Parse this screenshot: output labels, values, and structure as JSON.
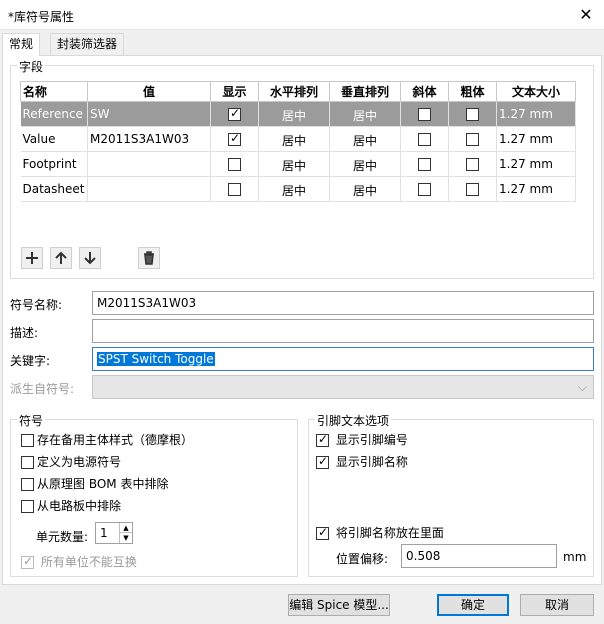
{
  "window": {
    "title": "*库符号属性",
    "close_glyph": "✕"
  },
  "tabs": [
    "常规",
    "封装筛选器"
  ],
  "fields_group": {
    "label": "字段",
    "columns": [
      "名称",
      "值",
      "显示",
      "水平排列",
      "垂直排列",
      "斜体",
      "粗体",
      "文本大小"
    ],
    "rows": [
      {
        "name": "Reference",
        "value": "SW",
        "show": true,
        "h_align": "居中",
        "v_align": "居中",
        "italic": false,
        "bold": false,
        "size": "1.27 mm",
        "selected": true
      },
      {
        "name": "Value",
        "value": "M2011S3A1W03",
        "show": true,
        "h_align": "居中",
        "v_align": "居中",
        "italic": false,
        "bold": false,
        "size": "1.27 mm",
        "selected": false
      },
      {
        "name": "Footprint",
        "value": "",
        "show": false,
        "h_align": "居中",
        "v_align": "居中",
        "italic": false,
        "bold": false,
        "size": "1.27 mm",
        "selected": false
      },
      {
        "name": "Datasheet",
        "value": "",
        "show": false,
        "h_align": "居中",
        "v_align": "居中",
        "italic": false,
        "bold": false,
        "size": "1.27 mm",
        "selected": false
      }
    ],
    "toolbar_icons": [
      "plus-icon",
      "arrow-up-icon",
      "arrow-down-icon",
      "trash-icon"
    ]
  },
  "form": {
    "symbol_name_label": "符号名称:",
    "symbol_name_value": "M2011S3A1W03",
    "description_label": "描述:",
    "description_value": "",
    "keywords_label": "关键字:",
    "keywords_value": "SPST Switch Toggle",
    "derived_label": "派生自符号:",
    "derived_value": ""
  },
  "symbol_group": {
    "label": "符号",
    "options": [
      {
        "label": "存在备用主体样式（德摩根）",
        "checked": false
      },
      {
        "label": "定义为电源符号",
        "checked": false
      },
      {
        "label": "从原理图 BOM 表中排除",
        "checked": false
      },
      {
        "label": "从电路板中排除",
        "checked": false
      }
    ],
    "unit_count_label": "单元数量:",
    "unit_count_value": "1",
    "interchangeable_label": "所有单位不能互换",
    "interchangeable_checked": true
  },
  "pin_group": {
    "label": "引脚文本选项",
    "show_pin_number_label": "显示引脚编号",
    "show_pin_number": true,
    "show_pin_name_label": "显示引脚名称",
    "show_pin_name": true,
    "pin_name_inside_label": "将引脚名称放在里面",
    "pin_name_inside": true,
    "offset_label": "位置偏移:",
    "offset_value": "0.508",
    "offset_unit": "mm"
  },
  "buttons": {
    "edit_spice": "编辑 Spice 模型...",
    "ok": "确定",
    "cancel": "取消"
  },
  "colors": {
    "selected_row": "#9b9b9b",
    "focus": "#0078d7"
  }
}
